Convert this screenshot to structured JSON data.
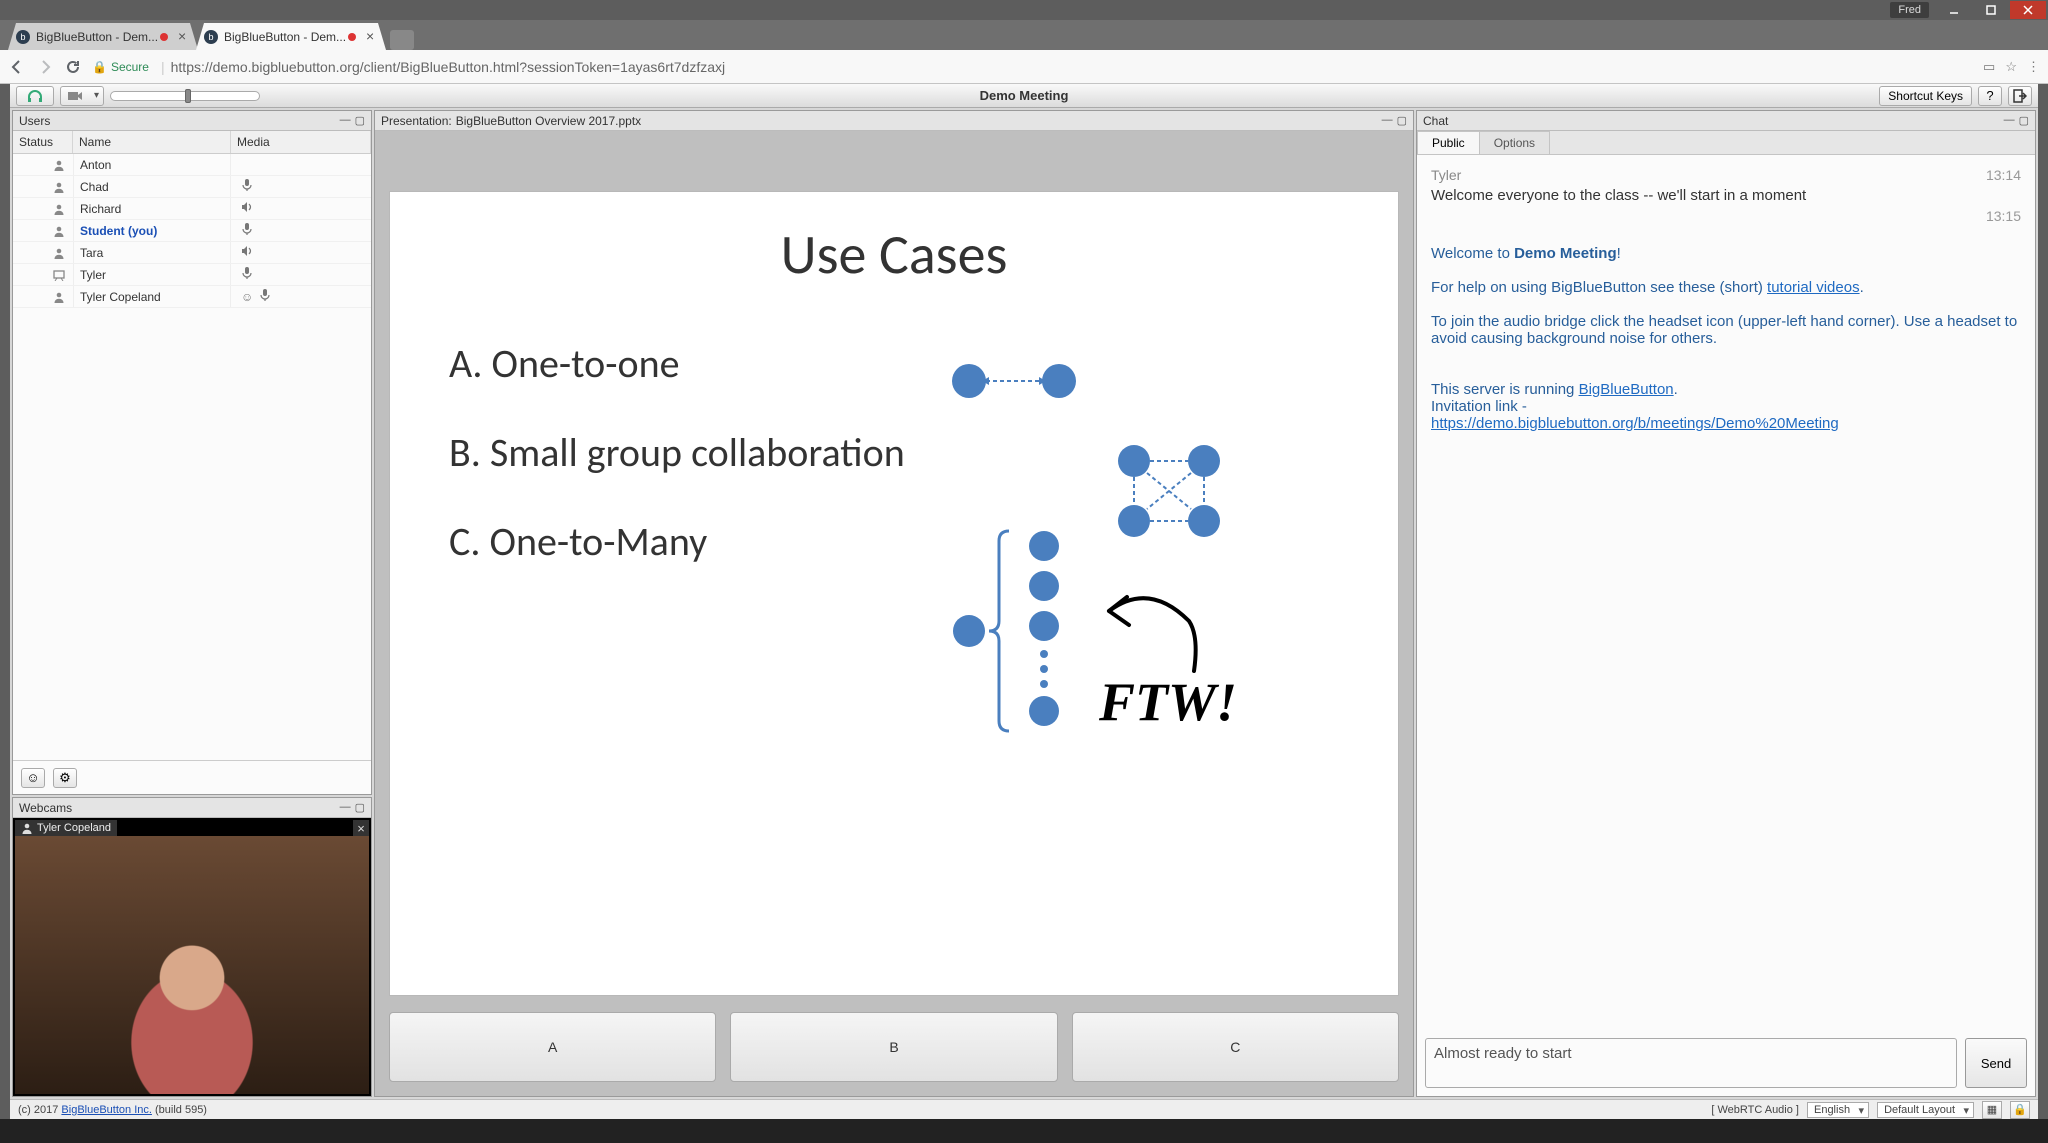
{
  "browser": {
    "user": "Fred",
    "tabs": [
      {
        "title": "BigBlueButton - Dem..."
      },
      {
        "title": "BigBlueButton - Dem..."
      }
    ],
    "url_secure": "Secure",
    "url": "https://demo.bigbluebutton.org/client/BigBlueButton.html?sessionToken=1ayas6rt7dzfzaxj"
  },
  "toolbar": {
    "meeting_title": "Demo Meeting",
    "shortcut_keys": "Shortcut Keys"
  },
  "users": {
    "title": "Users",
    "columns": {
      "status": "Status",
      "name": "Name",
      "media": "Media"
    },
    "list": [
      {
        "name": "Anton",
        "you": false,
        "presenter": false,
        "mic": false,
        "listen": false
      },
      {
        "name": "Chad",
        "you": false,
        "presenter": false,
        "mic": true,
        "listen": false
      },
      {
        "name": "Richard",
        "you": false,
        "presenter": false,
        "mic": false,
        "listen": true
      },
      {
        "name": "Student (you)",
        "you": true,
        "presenter": false,
        "mic": true,
        "listen": false
      },
      {
        "name": "Tara",
        "you": false,
        "presenter": false,
        "mic": false,
        "listen": true
      },
      {
        "name": "Tyler",
        "you": false,
        "presenter": true,
        "mic": true,
        "listen": false
      },
      {
        "name": "Tyler Copeland",
        "you": false,
        "presenter": false,
        "mic": true,
        "listen": false,
        "emoji": true
      }
    ]
  },
  "webcams": {
    "title": "Webcams",
    "stream_name": "Tyler Copeland"
  },
  "presentation": {
    "prefix": "Presentation:",
    "file": "BigBlueButton Overview 2017.pptx",
    "slide": {
      "title": "Use Cases",
      "bullets": [
        "A.  One-to-one",
        "B.  Small group collaboration",
        "C.  One-to-Many"
      ],
      "annotation": "FTW!"
    },
    "poll": [
      "A",
      "B",
      "C"
    ]
  },
  "chat": {
    "title": "Chat",
    "tabs": {
      "public": "Public",
      "options": "Options"
    },
    "items": [
      {
        "type": "meta",
        "sender": "Tyler",
        "time": "13:14"
      },
      {
        "type": "msg",
        "text": "Welcome everyone to the class -- we'll start in a moment"
      },
      {
        "type": "meta",
        "sender": "",
        "time": "13:15"
      }
    ],
    "welcome": {
      "l1a": "Welcome to ",
      "l1b": "Demo Meeting",
      "l1c": "!",
      "l2a": "For help on using BigBlueButton see these (short) ",
      "l2_link": "tutorial videos",
      "l2b": ".",
      "l3": "To join the audio bridge click the headset icon (upper-left hand corner).  Use a headset to avoid causing background noise for others.",
      "l4a": "This server is running ",
      "l4_link": "BigBlueButton",
      "l4b": ".",
      "l5a": "Invitation link - ",
      "l5_link": "https://demo.bigbluebutton.org/b/meetings/Demo%20Meeting"
    },
    "input_value": "Almost ready to start",
    "send": "Send"
  },
  "footer": {
    "copyright_a": "(c) 2017 ",
    "copyright_link": "BigBlueButton Inc.",
    "copyright_b": " (build 595)",
    "webrtc": "[ WebRTC Audio ]",
    "language": "English",
    "layout": "Default Layout"
  }
}
